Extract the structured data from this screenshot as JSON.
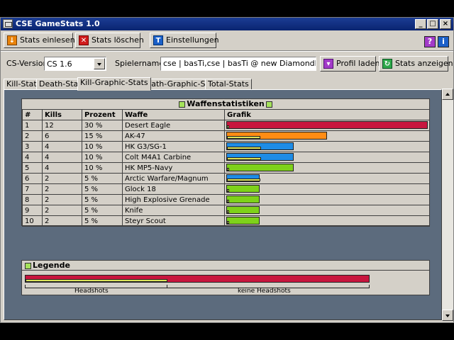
{
  "window": {
    "title": "CSE GameStats 1.0"
  },
  "toolbar": {
    "read_label": "Stats einlesen",
    "delete_label": "Stats löschen",
    "settings_label": "Einstellungen",
    "help_icon": "question-icon",
    "info_icon": "info-icon"
  },
  "settings": {
    "version_label": "CS-Version:",
    "version_value": "CS 1.6",
    "players_label": "Spielernamen:",
    "players_value": "cse | basTi,cse | basTi @ new Diamondback,hallo c",
    "load_profile_label": "Profil laden",
    "show_stats_label": "Stats anzeigen"
  },
  "tabs": [
    {
      "label": "Kill-Stats"
    },
    {
      "label": "Death-Stats"
    },
    {
      "label": "Kill-Graphic-Stats"
    },
    {
      "label": "Death-Graphic-Stats"
    },
    {
      "label": "Total-Stats"
    }
  ],
  "active_tab": "Kill-Graphic-Stats",
  "weapons": {
    "title": "Waffenstatistiken",
    "columns": [
      "#",
      "Kills",
      "Prozent",
      "Waffe",
      "Grafik"
    ],
    "rows": [
      {
        "rank": "1",
        "kills": "12",
        "percent": "30 %",
        "weapon": "Desert Eagle",
        "bar_value": 12,
        "headshots": 0,
        "color": "#c8163e"
      },
      {
        "rank": "2",
        "kills": "6",
        "percent": "15 %",
        "weapon": "AK-47",
        "bar_value": 6,
        "headshots": 2,
        "color": "#ff8c14"
      },
      {
        "rank": "3",
        "kills": "4",
        "percent": "10 %",
        "weapon": "HK G3/SG-1",
        "bar_value": 4,
        "headshots": 2,
        "color": "#1e8ce6"
      },
      {
        "rank": "4",
        "kills": "4",
        "percent": "10 %",
        "weapon": "Colt M4A1 Carbine",
        "bar_value": 4,
        "headshots": 2,
        "color": "#1e8ce6"
      },
      {
        "rank": "5",
        "kills": "4",
        "percent": "10 %",
        "weapon": "HK MP5-Navy",
        "bar_value": 4,
        "headshots": 0,
        "color": "#7ed11a"
      },
      {
        "rank": "6",
        "kills": "2",
        "percent": "5 %",
        "weapon": "Arctic Warfare/Magnum",
        "bar_value": 2,
        "headshots": 2,
        "color": "#1e8ce6"
      },
      {
        "rank": "7",
        "kills": "2",
        "percent": "5 %",
        "weapon": "Glock 18",
        "bar_value": 2,
        "headshots": 0,
        "color": "#7ed11a"
      },
      {
        "rank": "8",
        "kills": "2",
        "percent": "5 %",
        "weapon": "High Explosive Grenade",
        "bar_value": 2,
        "headshots": 0,
        "color": "#7ed11a"
      },
      {
        "rank": "9",
        "kills": "2",
        "percent": "5 %",
        "weapon": "Knife",
        "bar_value": 2,
        "headshots": 0,
        "color": "#7ed11a"
      },
      {
        "rank": "10",
        "kills": "2",
        "percent": "5 %",
        "weapon": "Steyr Scout",
        "bar_value": 2,
        "headshots": 0,
        "color": "#7ed11a"
      }
    ]
  },
  "legend": {
    "title": "Legende",
    "headshots_label": "Headshots",
    "no_headshots_label": "keine Headshots",
    "headshot_color": "#dce35a",
    "no_headshot_color": "#c8163e"
  }
}
